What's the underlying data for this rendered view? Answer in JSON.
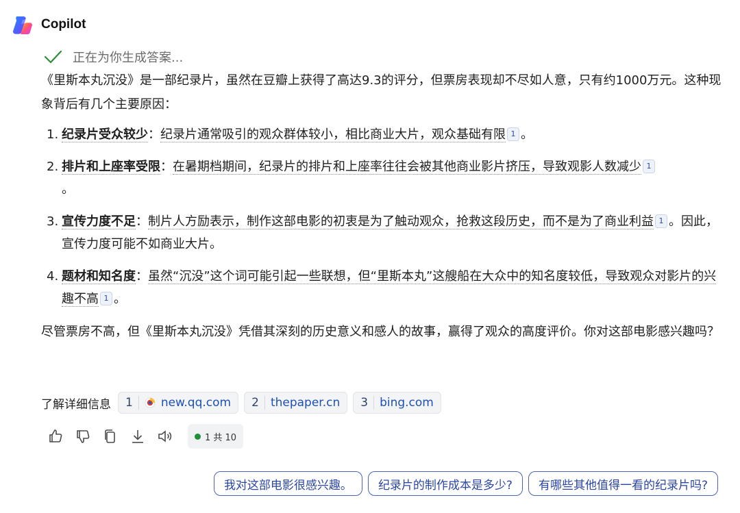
{
  "header": {
    "title": "Copilot",
    "logo_icon": "copilot-logo-icon"
  },
  "status": {
    "text": "正在为你生成答案..."
  },
  "answer": {
    "intro": "《里斯本丸沉没》是一部纪录片，虽然在豆瓣上获得了高达9.3的评分，但票房表现却不尽如人意，只有约1000万元。这种现象背后有几个主要原因：",
    "items": [
      {
        "num": "1.",
        "title": "纪录片受众较少",
        "sep": "：",
        "text": "纪录片通常吸引的观众群体较小，相比商业大片，观众基础有限",
        "cite": "1",
        "end": "。"
      },
      {
        "num": "2.",
        "title": "排片和上座率受限",
        "sep": "：",
        "text": "在暑期档期间，纪录片的排片和上座率往往会被其他商业影片挤压，导致观影人数减少",
        "cite": "1",
        "end": "。"
      },
      {
        "num": "3.",
        "title": "宣传力度不足",
        "sep": "：",
        "text": "制片人方励表示，制作这部电影的初衷是为了触动观众，抢救这段历史，而不是为了商业利益",
        "cite": "1",
        "end": "。因此，宣传力度可能不如商业大片。"
      },
      {
        "num": "4.",
        "title": "题材和知名度",
        "sep": "：",
        "text": "虽然“沉没”这个词可能引起一些联想，但“里斯本丸”这艘船在大众中的知名度较低，导致观众对影片的兴趣不高",
        "cite": "1",
        "end": "。"
      }
    ],
    "conclusion": "尽管票房不高，但《里斯本丸沉没》凭借其深刻的历史意义和感人的故事，赢得了观众的高度评价。你对这部电影感兴趣吗？"
  },
  "learn_more": {
    "label": "了解详细信息",
    "sources": [
      {
        "num": "1",
        "domain": "new.qq.com",
        "icon": "qq-news-icon"
      },
      {
        "num": "2",
        "domain": "thepaper.cn"
      },
      {
        "num": "3",
        "domain": "bing.com"
      }
    ]
  },
  "actions": {
    "icons": [
      "thumbs-up-icon",
      "thumbs-down-icon",
      "copy-icon",
      "download-icon",
      "read-aloud-icon"
    ],
    "counter": "1 共 10"
  },
  "suggestions": [
    "我对这部电影很感兴趣。",
    "纪录片的制作成本是多少?",
    "有哪些其他值得一看的纪录片吗?"
  ],
  "colors": {
    "accent": "#2b46a3",
    "link": "#1f4fb8",
    "check": "#2e8b3a",
    "status_dot": "#1f8f3a"
  }
}
